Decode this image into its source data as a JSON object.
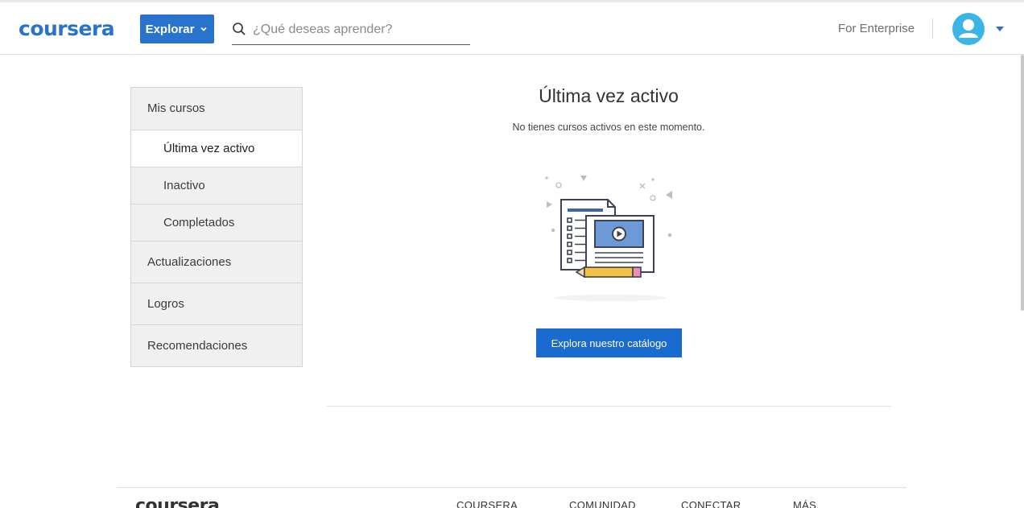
{
  "header": {
    "logo": "coursera",
    "explore_label": "Explorar",
    "search_placeholder": "¿Qué deseas aprender?",
    "enterprise_label": "For Enterprise"
  },
  "sidebar": {
    "items": [
      {
        "label": "Mis cursos",
        "level": "top"
      },
      {
        "label": "Última vez activo",
        "level": "sub",
        "active": true
      },
      {
        "label": "Inactivo",
        "level": "sub"
      },
      {
        "label": "Completados",
        "level": "sub"
      },
      {
        "label": "Actualizaciones",
        "level": "top"
      },
      {
        "label": "Logros",
        "level": "top"
      },
      {
        "label": "Recomendaciones",
        "level": "top"
      }
    ]
  },
  "main": {
    "title": "Última vez activo",
    "subtitle": "No tienes cursos activos en este momento.",
    "catalog_button": "Explora nuestro catálogo"
  },
  "footer": {
    "logo": "coursera",
    "columns": [
      "COURSERA",
      "COMUNIDAD",
      "CONECTAR",
      "MÁS"
    ]
  },
  "colors": {
    "brand": "#2a73cc",
    "button": "#1a6bd0",
    "avatar": "#3ab5e6",
    "sidebar_bg": "#f0f0f0"
  },
  "icons": [
    "search-icon",
    "chevron-down-icon",
    "user-avatar-icon",
    "caret-down-icon",
    "course-document-illustration"
  ]
}
